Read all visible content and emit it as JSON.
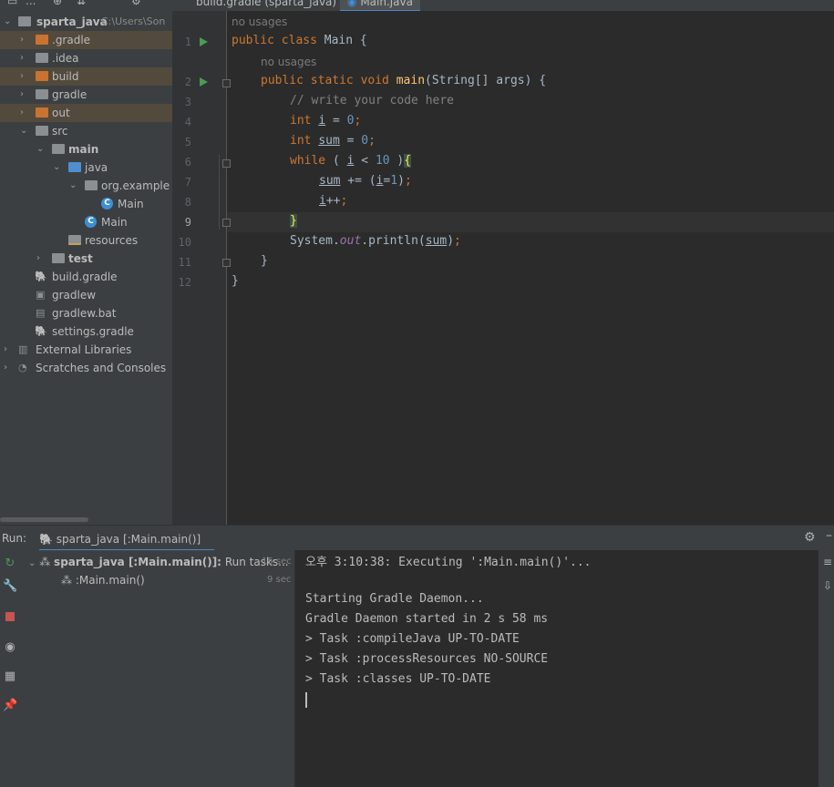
{
  "project_tree": {
    "toolbar_label": "...",
    "items": [
      {
        "label": "sparta_java",
        "hint": "C:\\Users\\Son"
      },
      {
        "label": ".gradle"
      },
      {
        "label": ".idea"
      },
      {
        "label": "build"
      },
      {
        "label": "gradle"
      },
      {
        "label": "out"
      },
      {
        "label": "src"
      },
      {
        "label": "main"
      },
      {
        "label": "java"
      },
      {
        "label": "org.example"
      },
      {
        "label": "Main"
      },
      {
        "label": "Main"
      },
      {
        "label": "resources"
      },
      {
        "label": "test"
      },
      {
        "label": "build.gradle"
      },
      {
        "label": "gradlew"
      },
      {
        "label": "gradlew.bat"
      },
      {
        "label": "settings.gradle"
      },
      {
        "label": "External Libraries"
      },
      {
        "label": "Scratches and Consoles"
      }
    ]
  },
  "editor_tabs": [
    {
      "label": "build.gradle (sparta_java)"
    },
    {
      "label": "Main.java"
    }
  ],
  "editor": {
    "inlay_hint": "no usages",
    "line_numbers": [
      "1",
      "2",
      "3",
      "4",
      "5",
      "6",
      "7",
      "8",
      "9",
      "10",
      "11",
      "12"
    ]
  },
  "run_panel": {
    "label": "Run:",
    "tab_label": "sparta_java [:Main.main()]",
    "tree": [
      {
        "label_bold": "sparta_java [:Main.main()]:",
        "label_rest": "Run tasks...",
        "time": "15 sec"
      },
      {
        "label": ":Main.main()",
        "time": "9 sec"
      }
    ],
    "console_lines": [
      "오후 3:10:38: Executing ':Main.main()'...",
      "",
      "Starting Gradle Daemon...",
      "Gradle Daemon started in 2 s 58 ms",
      "> Task :compileJava UP-TO-DATE",
      "> Task :processResources NO-SOURCE",
      "> Task :classes UP-TO-DATE"
    ]
  }
}
